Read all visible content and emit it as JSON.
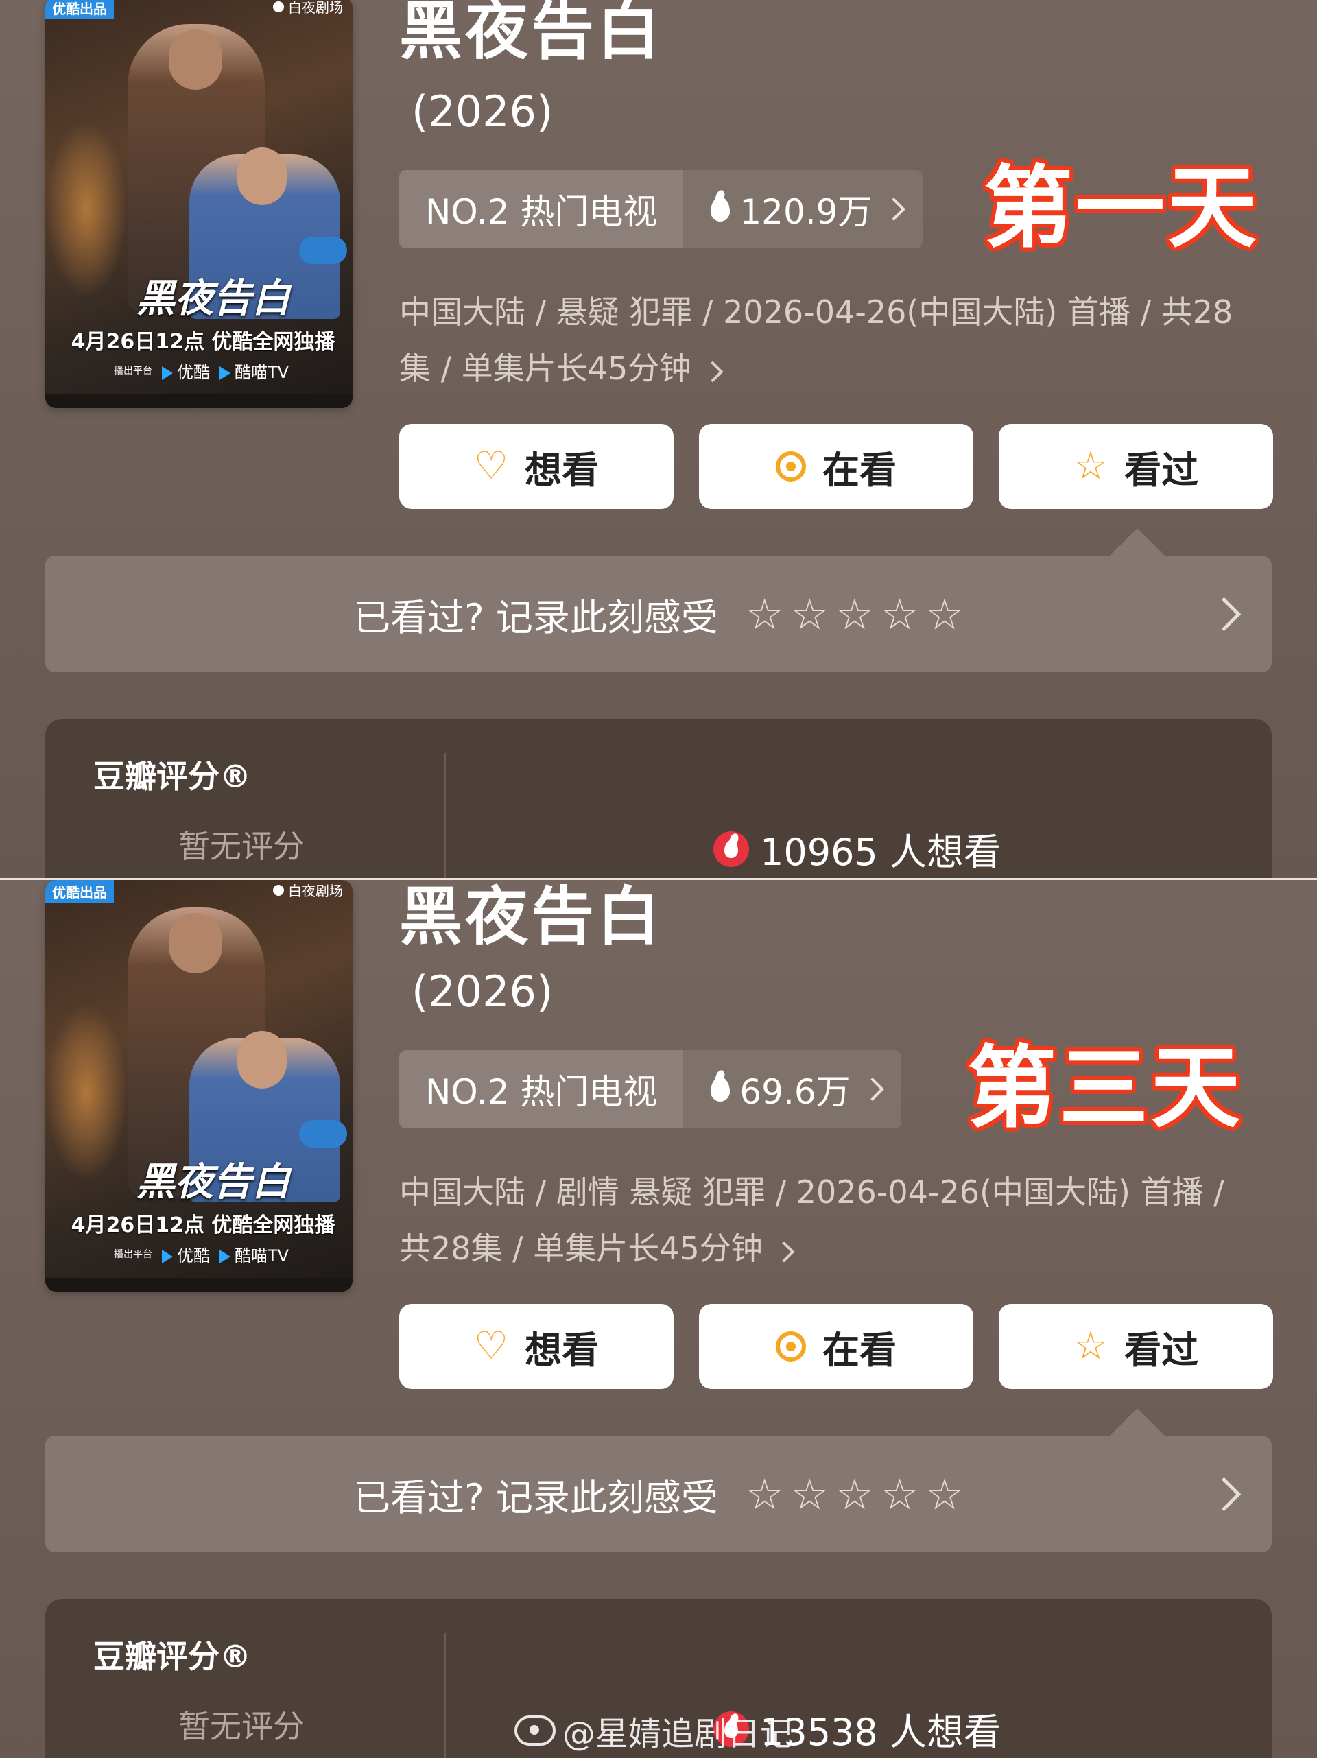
{
  "panels": [
    {
      "poster": {
        "tag_left": "优酷出品",
        "tag_right": "白夜剧场",
        "title_art": "黑夜告白",
        "air_info": "4月26日12点 优酷全网独播",
        "platform_label": "播出平台",
        "platform_1": "优酷",
        "platform_2": "酷喵TV"
      },
      "title": "黑夜告白",
      "year": "(2026)",
      "rank_label": "NO.2 热门电视",
      "heat_value": "120.9万",
      "stamp": "第一天",
      "meta": "中国大陆 / 悬疑 犯罪 / 2026-04-26(中国大陆) 首播 / 共28集 / 单集片长45分钟",
      "buttons": {
        "want": "想看",
        "watching": "在看",
        "watched": "看过"
      },
      "record_label": "已看过? 记录此刻感受",
      "score_label": "豆瓣评分®",
      "score_value": "暂无评分",
      "want_count": "10965 人想看"
    },
    {
      "poster": {
        "tag_left": "优酷出品",
        "tag_right": "白夜剧场",
        "title_art": "黑夜告白",
        "air_info": "4月26日12点 优酷全网独播",
        "platform_label": "播出平台",
        "platform_1": "优酷",
        "platform_2": "酷喵TV"
      },
      "title": "黑夜告白",
      "year": "(2026)",
      "rank_label": "NO.2 热门电视",
      "heat_value": "69.6万",
      "stamp": "第三天",
      "meta": "中国大陆 / 剧情 悬疑 犯罪 / 2026-04-26(中国大陆) 首播 / 共28集 / 单集片长45分钟",
      "buttons": {
        "want": "想看",
        "watching": "在看",
        "watched": "看过"
      },
      "record_label": "已看过? 记录此刻感受",
      "score_label": "豆瓣评分®",
      "score_value": "暂无评分",
      "want_count": "13538 人想看"
    }
  ],
  "rating_stars": [
    "☆",
    "☆",
    "☆",
    "☆",
    "☆"
  ],
  "watermark": "@星婧追剧日记",
  "colors": {
    "accent": "#f5a623",
    "stamp_outline": "#ef3b1c",
    "fire": "#e8333f"
  }
}
